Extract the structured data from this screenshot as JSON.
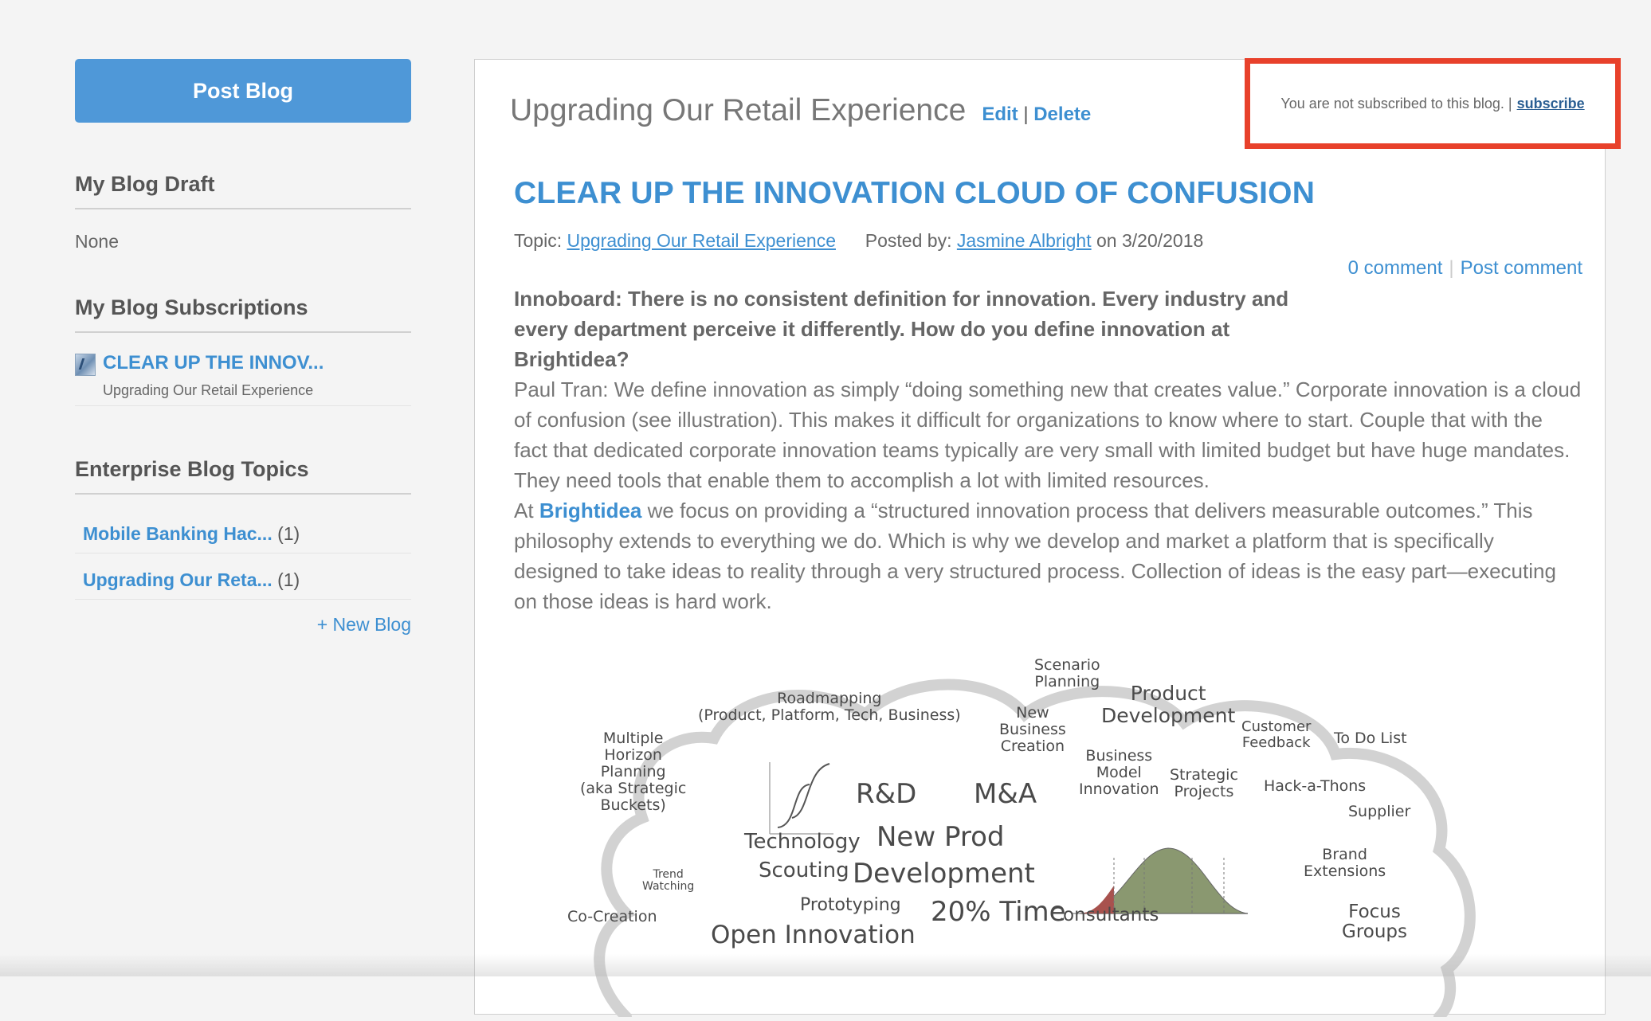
{
  "sidebar": {
    "post_blog_label": "Post Blog",
    "draft_heading": "My Blog Draft",
    "draft_value": "None",
    "subscriptions_heading": "My Blog Subscriptions",
    "subscriptions": [
      {
        "title": "CLEAR UP THE INNOV...",
        "topic": "Upgrading Our Retail Experience"
      }
    ],
    "topics_heading": "Enterprise Blog Topics",
    "topics": [
      {
        "label": "Mobile Banking Hac...",
        "count": "(1)"
      },
      {
        "label": "Upgrading Our Reta...",
        "count": "(1)"
      }
    ],
    "new_blog_label": "+ New Blog"
  },
  "blog": {
    "title": "Upgrading Our Retail Experience",
    "edit_label": "Edit",
    "separator": "|",
    "delete_label": "Delete",
    "subscription_status": "You are not subscribed to this blog. |",
    "subscribe_label": "subscribe"
  },
  "post": {
    "title": "CLEAR UP THE INNOVATION CLOUD OF CONFUSION",
    "topic_prefix": "Topic:",
    "topic": "Upgrading Our Retail Experience",
    "posted_by_prefix": "Posted by:",
    "author": "Jasmine Albright",
    "date_text": "on 3/20/2018",
    "comment_count_label": "0 comment",
    "post_comment_label": "Post comment",
    "question": "Innoboard: There is no consistent definition for innovation. Every industry and every department perceive it differently. How do you define innovation at Brightidea?",
    "paragraph1": "Paul Tran: We define innovation as simply “doing something new that creates value.” Corporate innovation is a cloud of confusion (see illustration). This makes it difficult for organizations to know where to start. Couple that with the fact that dedicated corporate innovation teams typically are very small with limited budget but have huge mandates. They need tools that enable them to accomplish a lot with limited resources.",
    "paragraph2_prefix": "At",
    "brand": "Brightidea",
    "paragraph2_rest": "we focus on providing a “structured innovation process that delivers measurable outcomes.” This philosophy extends to everything we do. Which is why we develop and market a platform that is specifically designed to take ideas to reality through a very structured process. Collection of ideas is the easy part—executing on those ideas is hard work."
  },
  "illustration": {
    "words": [
      "Scenario\nPlanning",
      "Product\nDevelopment",
      "Roadmapping\n(Product, Platform, Tech, Business)",
      "New\nBusiness\nCreation",
      "Customer\nFeedback",
      "To Do List",
      "Multiple\nHorizon\nPlanning\n(aka Strategic\nBuckets)",
      "Business\nModel\nInnovation",
      "Strategic\nProjects",
      "R&D",
      "M&A",
      "Hack-a-Thons",
      "Supplier",
      "New Prod",
      "Technology",
      "Scouting",
      "Development",
      "Brand\nExtensions",
      "Trend\nWatching",
      "Prototyping",
      "Co-Creation",
      "20% Time",
      "Consultants",
      "Focus\nGroups",
      "Open Innovation"
    ]
  }
}
